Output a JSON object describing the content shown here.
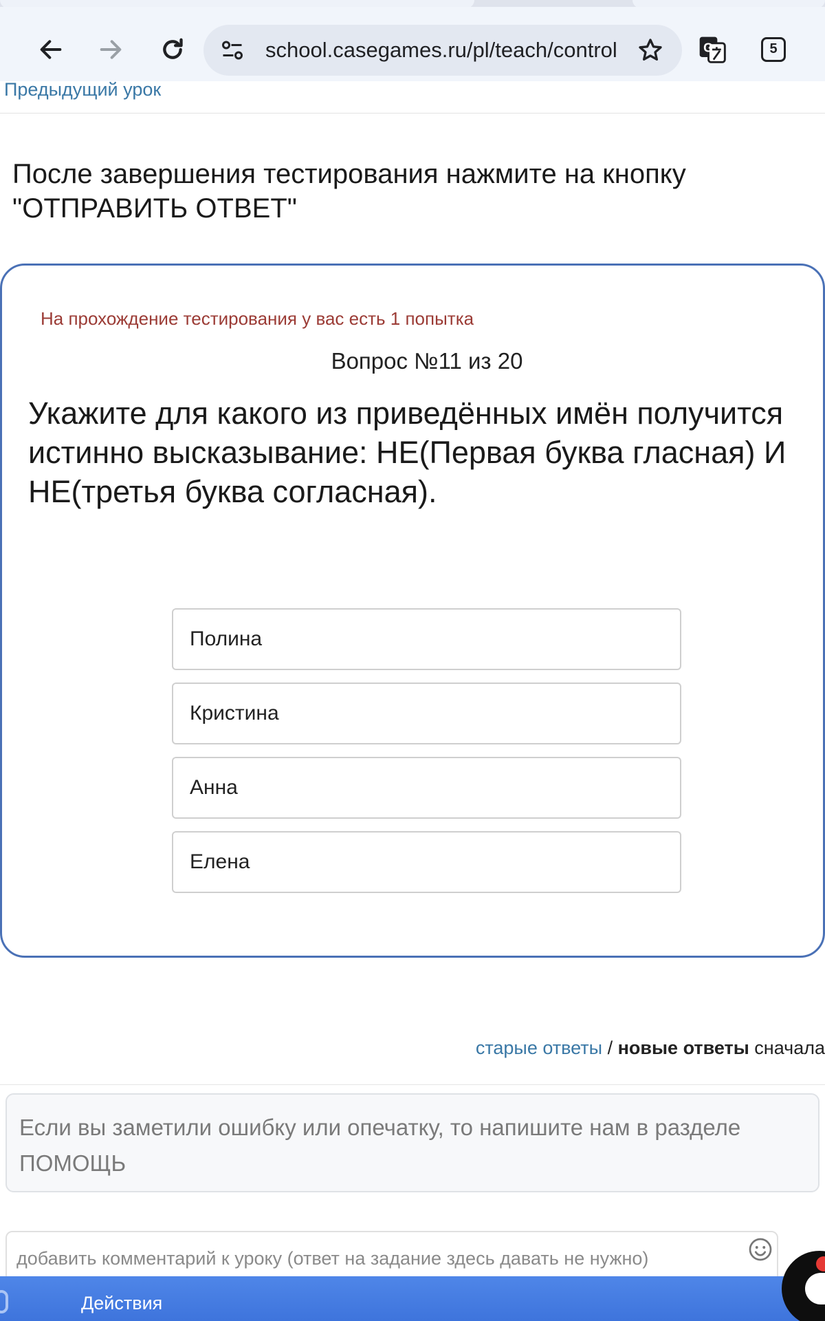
{
  "browser": {
    "url": "school.casegames.ru/pl/teach/control",
    "tab_count": "5",
    "accent": "#f1f5fb"
  },
  "page": {
    "prev_lesson": "Предыдущий урок",
    "instruction": "После завершения тестирования нажмите на кнопку \"ОТПРАВИТЬ ОТВЕТ\""
  },
  "test": {
    "attempts": "На прохождение тестирования у вас есть 1 попытка",
    "question_number": "Вопрос №11 из 20",
    "question_text": "Укажите для какого из приведённых имён получится истинно высказывание: НЕ(Первая буква гласная) И НЕ(третья буква согласная).",
    "options": [
      "Полина",
      "Кристина",
      "Анна",
      "Елена"
    ],
    "border_color": "#4a71b6"
  },
  "comments": {
    "old_answers": "старые ответы",
    "separator": " / ",
    "new_answers": "новые ответы",
    "first": " сначала",
    "notice": "Если вы заметили ошибку или опечатку, то напишите нам в разделе ПОМОЩЬ",
    "comment_placeholder": "добавить комментарий к уроку (ответ на задание здесь давать не нужно)"
  },
  "footer": {
    "actions_label": "Действия"
  },
  "icons": {
    "back": "arrow-left-icon",
    "forward": "arrow-right-icon",
    "reload": "reload-icon",
    "site_settings": "tune-icon",
    "bookmark": "star-icon",
    "translate": "translate-icon",
    "tabs": "tab-counter-icon",
    "emoji": "smiley-icon",
    "chat": "chat-bubble-icon"
  }
}
